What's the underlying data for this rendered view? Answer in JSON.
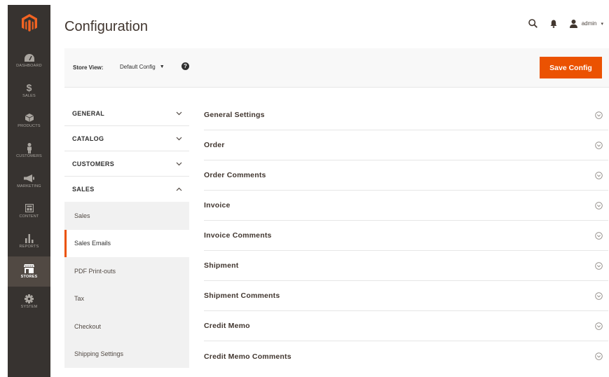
{
  "sidebar": {
    "items": [
      {
        "label": "DASHBOARD",
        "icon": "dashboard-icon"
      },
      {
        "label": "SALES",
        "icon": "dollar-icon"
      },
      {
        "label": "PRODUCTS",
        "icon": "cube-icon"
      },
      {
        "label": "CUSTOMERS",
        "icon": "person-icon"
      },
      {
        "label": "MARKETING",
        "icon": "megaphone-icon"
      },
      {
        "label": "CONTENT",
        "icon": "layout-icon"
      },
      {
        "label": "REPORTS",
        "icon": "bar-chart-icon"
      },
      {
        "label": "STORES",
        "icon": "store-icon",
        "active": true
      },
      {
        "label": "SYSTEM",
        "icon": "gear-icon"
      }
    ]
  },
  "header": {
    "title": "Configuration",
    "user": "admin"
  },
  "toolbar": {
    "store_view_label": "Store View:",
    "store_view_value": "Default Config",
    "help": "?",
    "save_label": "Save Config"
  },
  "nav": {
    "groups": [
      {
        "label": "GENERAL",
        "expanded": false
      },
      {
        "label": "CATALOG",
        "expanded": false
      },
      {
        "label": "CUSTOMERS",
        "expanded": false
      },
      {
        "label": "SALES",
        "expanded": true
      }
    ],
    "sales_items": [
      {
        "label": "Sales",
        "active": false
      },
      {
        "label": "Sales Emails",
        "active": true
      },
      {
        "label": "PDF Print-outs",
        "active": false
      },
      {
        "label": "Tax",
        "active": false
      },
      {
        "label": "Checkout",
        "active": false
      },
      {
        "label": "Shipping Settings",
        "active": false
      }
    ]
  },
  "sections": [
    "General Settings",
    "Order",
    "Order Comments",
    "Invoice",
    "Invoice Comments",
    "Shipment",
    "Shipment Comments",
    "Credit Memo",
    "Credit Memo Comments"
  ],
  "colors": {
    "sidebar_bg": "#373330",
    "sidebar_active": "#514943",
    "accent": "#eb5202",
    "logo": "#f26322"
  }
}
